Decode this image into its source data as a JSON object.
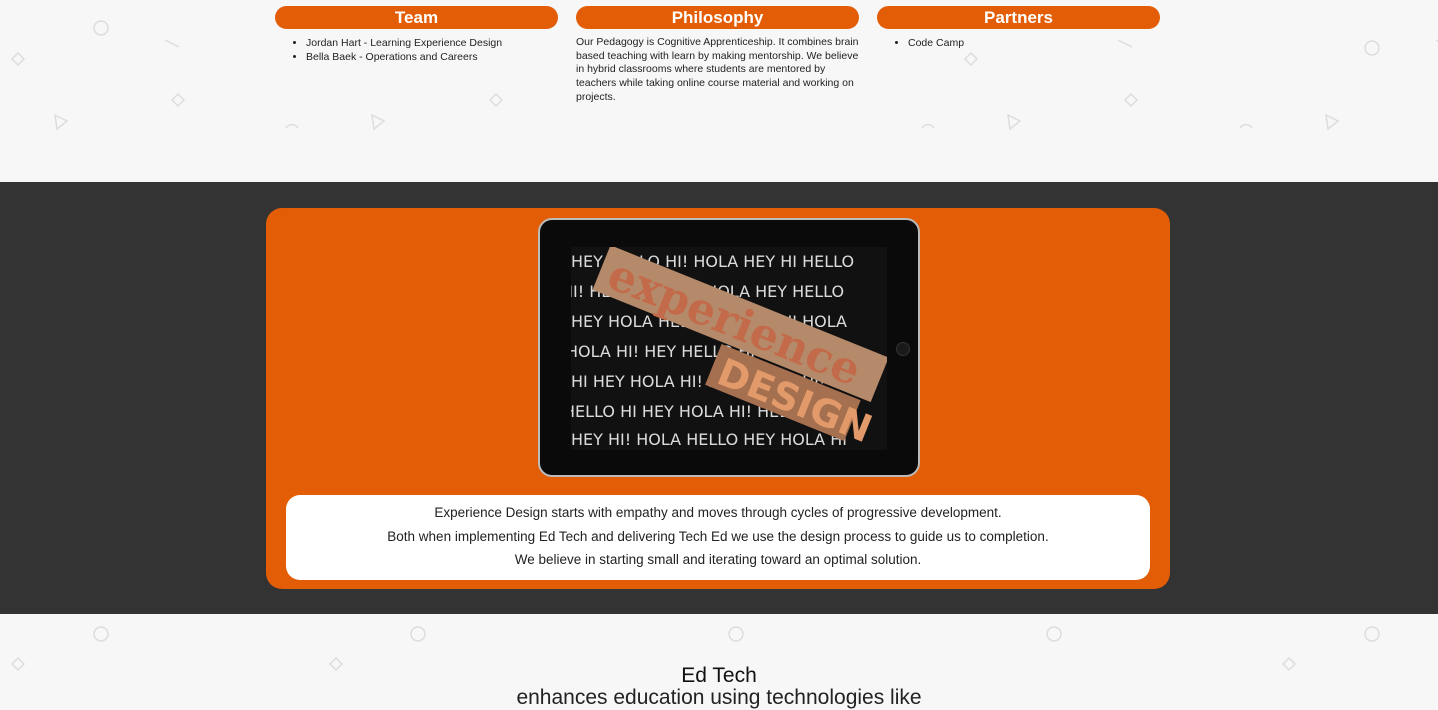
{
  "top": {
    "team": {
      "title": "Team",
      "members": [
        "Jordan Hart - Learning Experience Design",
        "Bella Baek - Operations and Careers"
      ]
    },
    "philosophy": {
      "title": "Philosophy",
      "text": "Our Pedagogy is Cognitive Apprenticeship. It combines brain based teaching with learn by making mentorship. We believe in hybrid classrooms where students are mentored by teachers while taking online course material and working on projects."
    },
    "partners": {
      "title": "Partners",
      "items": [
        "Code Camp"
      ]
    }
  },
  "feature": {
    "image_words": [
      "experience",
      "DESIGN"
    ],
    "lines": [
      "Experience Design starts with empathy and moves through cycles of progressive development.",
      "Both when implementing Ed Tech and delivering Tech Ed we use the design process to guide us to completion.",
      "We believe in starting small and iterating toward an optimal solution."
    ]
  },
  "edtech": {
    "title": "Ed Tech",
    "subtitle": "enhances education using technologies like"
  },
  "colors": {
    "accent": "#e35d06",
    "dark": "#333333"
  }
}
